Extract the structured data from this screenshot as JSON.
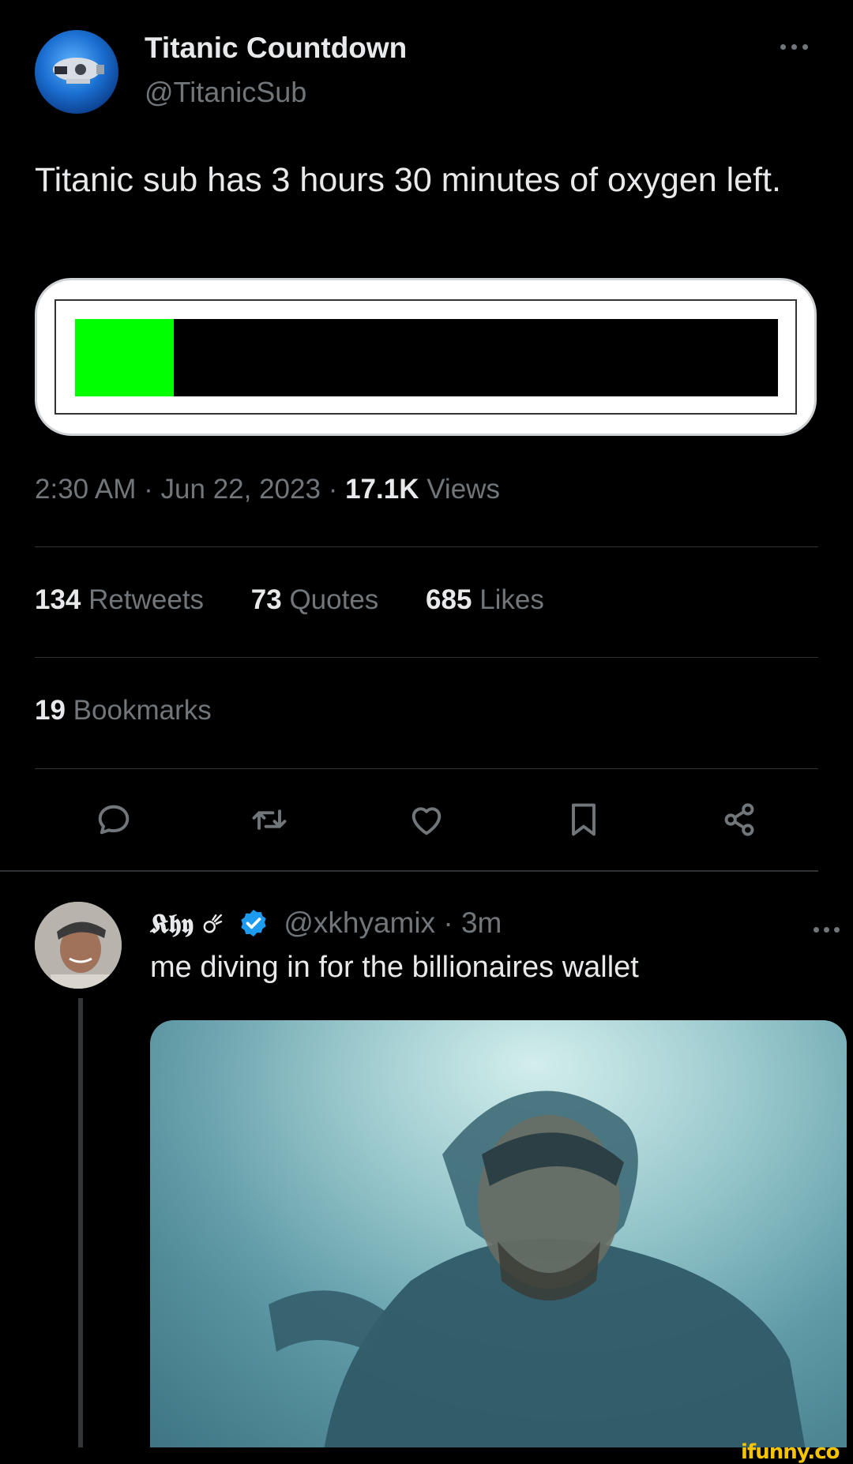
{
  "tweet": {
    "author_name": "Titanic Countdown",
    "author_handle": "@TitanicSub",
    "text": "Titanic sub has 3 hours 30 minutes of oxygen left.",
    "oxygen_level_fraction": 0.14,
    "oxygen_fill_color": "#00ff00",
    "time": "2:30 AM",
    "separator": "·",
    "date": "Jun 22, 2023",
    "views_count": "17.1K",
    "views_label": "Views",
    "stats": [
      {
        "count": "134",
        "label": "Retweets"
      },
      {
        "count": "73",
        "label": "Quotes"
      },
      {
        "count": "685",
        "label": "Likes"
      }
    ],
    "bookmarks_count": "19",
    "bookmarks_label": "Bookmarks",
    "actions": [
      "reply-icon",
      "retweet-icon",
      "like-icon",
      "bookmark-icon",
      "share-icon"
    ]
  },
  "reply": {
    "name": "𝕶𝖍𝖞 ☄",
    "verified_color": "#1d9bf0",
    "handle": "@xkhyamix",
    "time": "3m",
    "text": "me diving in for the billionaires wallet"
  },
  "watermark": "ifunny.co"
}
